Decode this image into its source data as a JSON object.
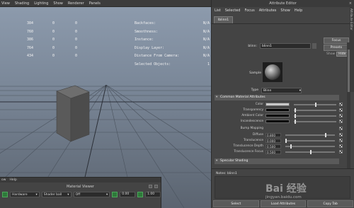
{
  "viewport": {
    "menu": [
      "View",
      "Shading",
      "Lighting",
      "Show",
      "Renderer",
      "Panels"
    ],
    "stats_rows": [
      {
        "label": "",
        "a": "384",
        "b": "0",
        "c": "0"
      },
      {
        "label": "",
        "a": "760",
        "b": "0",
        "c": "0"
      },
      {
        "label": "",
        "a": "386",
        "b": "0",
        "c": "0"
      },
      {
        "label": "",
        "a": "764",
        "b": "0",
        "c": "0"
      },
      {
        "label": "",
        "a": "434",
        "b": "0",
        "c": "0"
      }
    ],
    "info_rows": [
      {
        "label": "Backfaces:",
        "value": "N/A"
      },
      {
        "label": "Smoothness:",
        "value": "N/A"
      },
      {
        "label": "Instance:",
        "value": "N/A"
      },
      {
        "label": "Display Layer:",
        "value": "N/A"
      },
      {
        "label": "Distance From Camera:",
        "value": "N/A"
      },
      {
        "label": "Selected Objects:",
        "value": "1"
      }
    ]
  },
  "material_viewer": {
    "topbar": [
      "ow",
      "Help"
    ],
    "title": "Material Viewer",
    "renderer": "Hardware",
    "shape": "Shader ball",
    "env": "Off",
    "value1": "0.00",
    "value2": "1.00"
  },
  "attribute_editor": {
    "title": "Attribute Editor",
    "menu": [
      "List",
      "Selected",
      "Focus",
      "Attributes",
      "Show",
      "Help"
    ],
    "tab": "lblinn1",
    "node_label": "blinn:",
    "node_name": "blinn1",
    "buttons": {
      "focus": "Focus",
      "presets": "Presets",
      "show": "Show",
      "hide": "Hide"
    },
    "sample_label": "Sample",
    "type_label": "Type",
    "type_value": "Blinn",
    "sections": {
      "common": "Common Material Attributes",
      "specular": "Specular Shading"
    },
    "attributes": [
      {
        "label": "Color",
        "kind": "swatch",
        "color": "#c8c8c8",
        "slider": 0.5
      },
      {
        "label": "Transparency",
        "kind": "swatch",
        "color": "#050505",
        "slider": 0.02
      },
      {
        "label": "Ambient Color",
        "kind": "swatch",
        "color": "#050505",
        "slider": 0.02
      },
      {
        "label": "Incandescence",
        "kind": "swatch",
        "color": "#050505",
        "slider": 0.02
      },
      {
        "label": "Bump Mapping",
        "kind": "none"
      },
      {
        "label": "Diffuse",
        "kind": "num",
        "value": "0.800",
        "slider": 0.8
      },
      {
        "label": "Translucence",
        "kind": "num",
        "value": "0.000",
        "slider": 0.0
      },
      {
        "label": "Translucence Depth",
        "kind": "num",
        "value": "0.500",
        "slider": 0.1
      },
      {
        "label": "Translucence Focus",
        "kind": "num",
        "value": "0.500",
        "slider": 0.5
      }
    ],
    "notes_label": "Notes: blinn1",
    "bottom_buttons": [
      "Select",
      "Load Attributes",
      "Copy Tab"
    ],
    "side_strip": "Attribute Editor"
  },
  "watermark": {
    "logo": "Bai 经验",
    "url": "jingyan.baidu.com"
  },
  "colors": {
    "panel_bg": "#444444",
    "viewport_top": "#8e9cae",
    "viewport_bottom": "#5b6470"
  }
}
